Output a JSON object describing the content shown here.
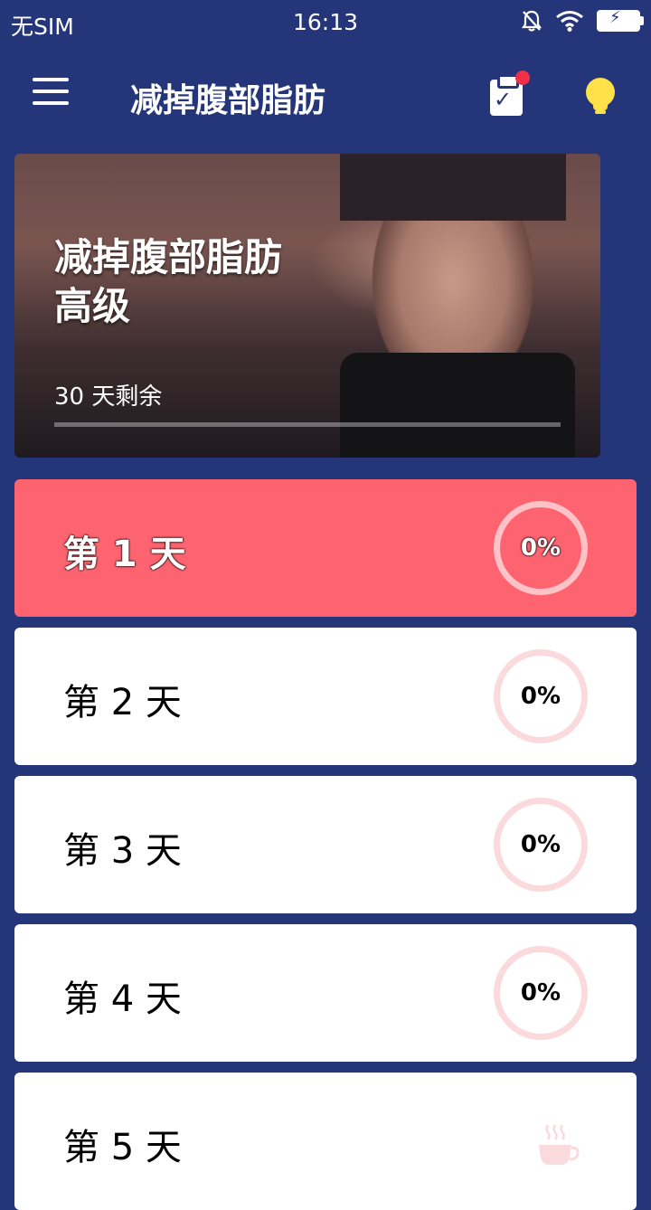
{
  "status_bar": {
    "carrier": "无SIM",
    "time": "16:13",
    "battery_symbol": "⚡"
  },
  "app_bar": {
    "title": "减掉腹部脂肪",
    "icons": [
      "menu-icon",
      "clipboard-check-icon",
      "lightbulb-icon"
    ]
  },
  "hero": {
    "title_line1": "减掉腹部脂肪",
    "title_line2": "高级",
    "remaining": "30 天剩余",
    "progress": 0
  },
  "days": [
    {
      "label": "第 1 天",
      "progress": "0%",
      "active": true
    },
    {
      "label": "第 2 天",
      "progress": "0%"
    },
    {
      "label": "第 3 天",
      "progress": "0%"
    },
    {
      "label": "第 4 天",
      "progress": "0%"
    },
    {
      "label": "第 5 天",
      "rest_icon": "coffee-cup-icon"
    }
  ],
  "colors": {
    "background": "#243679",
    "active_day": "#fd6470",
    "ring": "#fadadd",
    "notification_dot": "#f0304a",
    "bulb": "#ffe14a"
  }
}
